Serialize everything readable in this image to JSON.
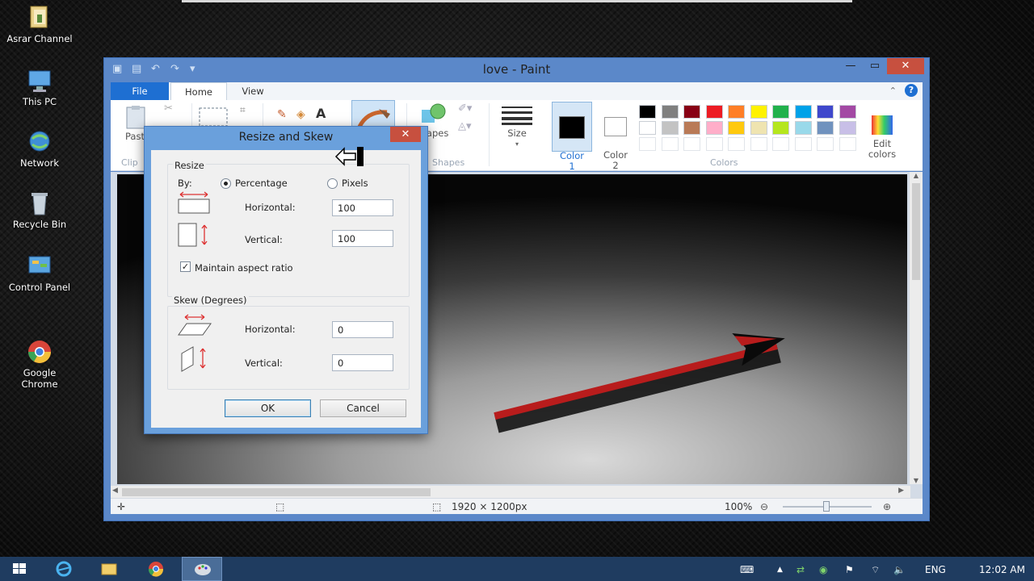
{
  "desktop": {
    "icons": [
      {
        "label": "Asrar Channel",
        "icon": "folder-icon"
      },
      {
        "label": "This PC",
        "icon": "computer-icon"
      },
      {
        "label": "Network",
        "icon": "network-icon"
      },
      {
        "label": "Recycle Bin",
        "icon": "recycle-bin-icon"
      },
      {
        "label": "Control Panel",
        "icon": "control-panel-icon"
      },
      {
        "label": "Google\nChrome",
        "icon": "chrome-icon"
      }
    ]
  },
  "paint": {
    "title": "love - Paint",
    "tabs": {
      "file": "File",
      "home": "Home",
      "view": "View"
    },
    "ribbon": {
      "paste": "Past",
      "clipboard_group": "Clip",
      "shapes_button": "hapes",
      "shapes_group": "Shapes",
      "size": "Size",
      "color1": "Color\n1",
      "color2": "Color\n2",
      "edit_colors": "Edit\ncolors",
      "colors_group": "Colors"
    },
    "palette_row1": [
      "#000000",
      "#7f7f7f",
      "#880015",
      "#ed1c24",
      "#ff7f27",
      "#fff200",
      "#22b14c",
      "#00a2e8",
      "#3f48cc",
      "#a349a4"
    ],
    "palette_row2": [
      "#ffffff",
      "#c3c3c3",
      "#b97a57",
      "#ffaec9",
      "#ffc90e",
      "#efe4b0",
      "#b5e61d",
      "#99d9ea",
      "#7092be",
      "#c8bfe7"
    ],
    "status": {
      "dimensions": "1920 × 1200px",
      "zoom": "100%"
    }
  },
  "dialog": {
    "title": "Resize and Skew",
    "resize_label": "Resize",
    "by_label": "By:",
    "percentage": "Percentage",
    "pixels": "Pixels",
    "horizontal_label": "Horizontal:",
    "vertical_label": "Vertical:",
    "resize_horizontal": "100",
    "resize_vertical": "100",
    "maintain_aspect": "Maintain aspect ratio",
    "skew_label": "Skew (Degrees)",
    "skew_horizontal": "0",
    "skew_vertical": "0",
    "ok": "OK",
    "cancel": "Cancel"
  },
  "taskbar": {
    "language": "ENG",
    "time": "12:02 AM"
  }
}
